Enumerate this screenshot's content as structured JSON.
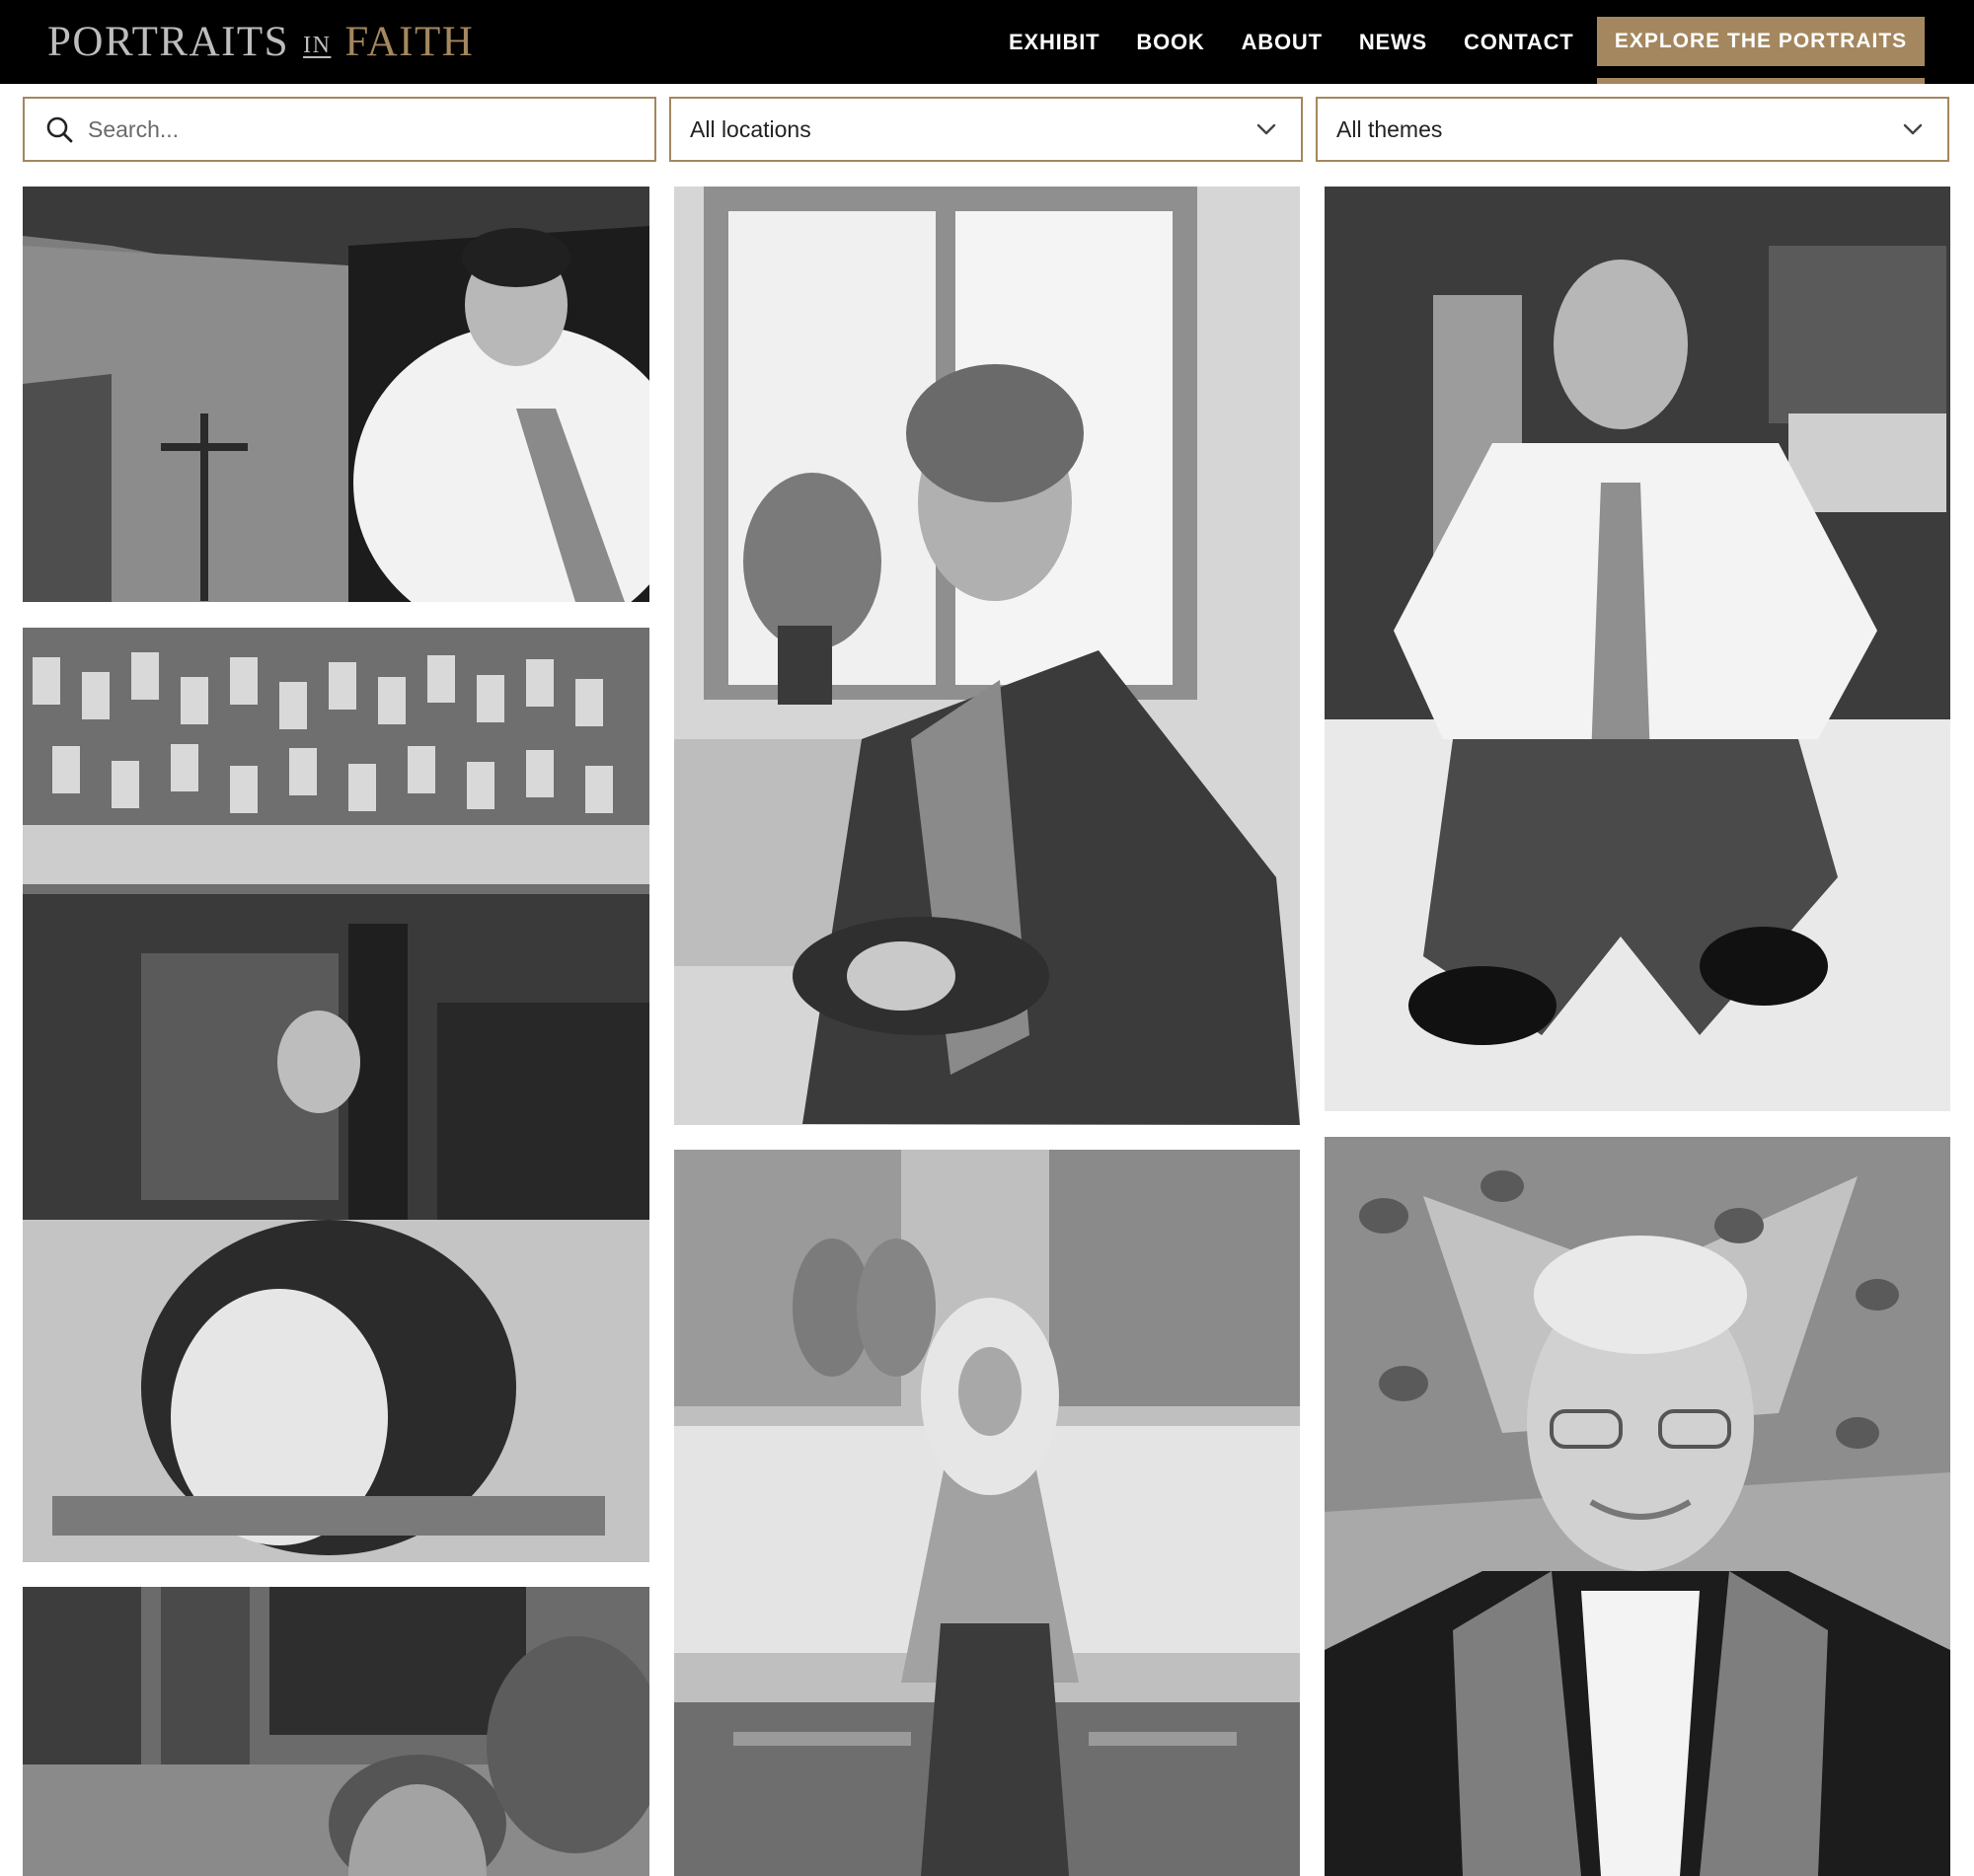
{
  "brand": {
    "word1": "PORTRAITS",
    "word2": "IN",
    "word3": "FAITH"
  },
  "nav": {
    "items": [
      {
        "label": "EXHIBIT"
      },
      {
        "label": "BOOK"
      },
      {
        "label": "ABOUT"
      },
      {
        "label": "NEWS"
      },
      {
        "label": "CONTACT"
      }
    ],
    "cta_label": "EXPLORE THE PORTRAITS"
  },
  "filters": {
    "search_placeholder": "Search...",
    "location_selected": "All locations",
    "theme_selected": "All themes"
  },
  "colors": {
    "accent": "#a4875e",
    "header_bg": "#000000"
  },
  "icons": {
    "search": "search-icon",
    "dropdown": "chevron-down-icon"
  }
}
